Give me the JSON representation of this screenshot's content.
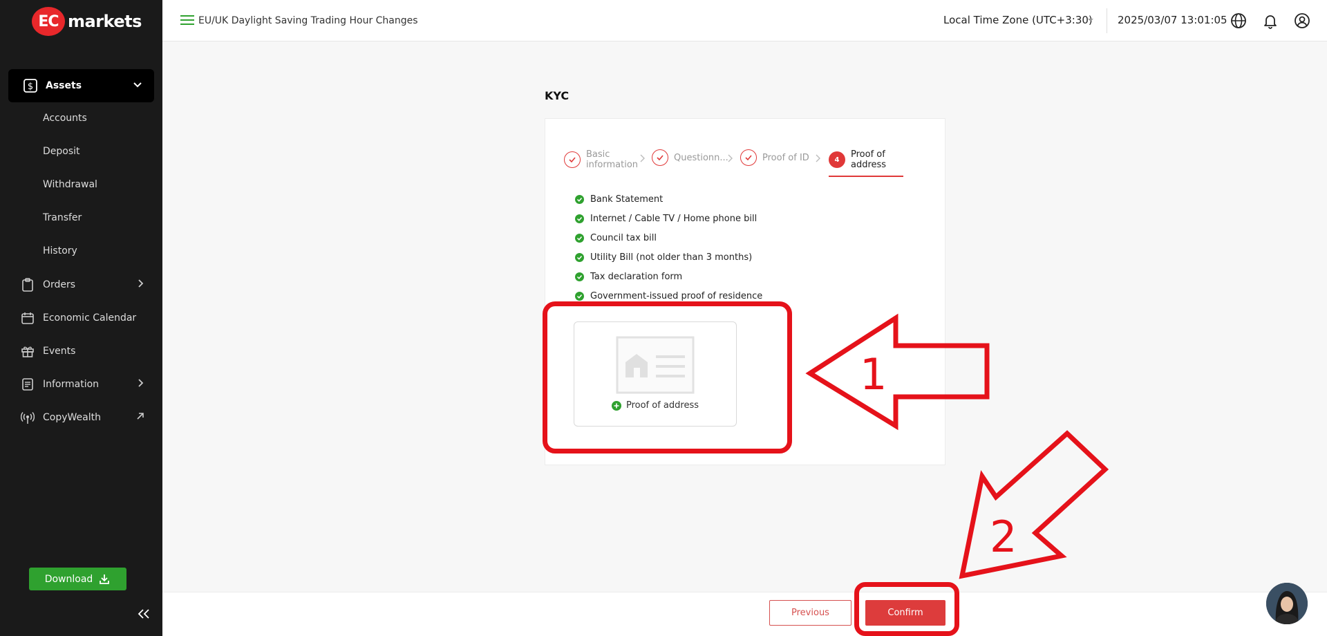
{
  "brand": {
    "logo_badge": "EC",
    "logo_text": "markets",
    "color": "#e8282b"
  },
  "sidebar": {
    "assets_label": "Assets",
    "sub_items": [
      "Accounts",
      "Deposit",
      "Withdrawal",
      "Transfer",
      "History"
    ],
    "items": [
      {
        "label": "Orders",
        "icon": "clipboard-icon",
        "right": "chevron-right-icon"
      },
      {
        "label": "Economic Calendar",
        "icon": "calendar-icon",
        "right": ""
      },
      {
        "label": "Events",
        "icon": "gift-icon",
        "right": ""
      },
      {
        "label": "Information",
        "icon": "document-icon",
        "right": "chevron-right-icon"
      },
      {
        "label": "CopyWealth",
        "icon": "broadcast-icon",
        "right": "external-arrow-icon"
      }
    ],
    "download_label": "Download"
  },
  "header": {
    "announcement": "EU/UK Daylight Saving Trading Hour Changes",
    "timezone": "Local Time Zone (UTC+3:30)",
    "clock": "2025/03/07 13:01:05"
  },
  "kyc": {
    "title": "KYC",
    "steps": [
      {
        "label": "Basic information",
        "state": "done"
      },
      {
        "label": "Questionn...",
        "state": "done"
      },
      {
        "label": "Proof of ID",
        "state": "done"
      },
      {
        "label": "Proof of address",
        "state": "active",
        "number": "4"
      }
    ],
    "documents": [
      "Bank Statement",
      "Internet / Cable TV / Home phone bill",
      "Council tax bill",
      "Utility Bill (not older than 3 months)",
      "Tax declaration form",
      "Government-issued proof of residence"
    ],
    "upload_label": "Proof of address"
  },
  "footer": {
    "previous_label": "Previous",
    "confirm_label": "Confirm"
  },
  "annotations": {
    "one": "1",
    "two": "2",
    "color": "#e5121a"
  }
}
